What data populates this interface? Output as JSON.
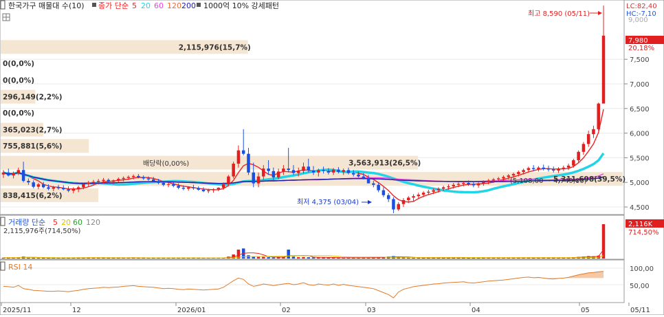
{
  "legend": {
    "title": "한국가구 매물대 수(10)",
    "ma_label": "종가 단순",
    "ma_periods": [
      "5",
      "20",
      "60",
      "120",
      "200"
    ],
    "ma_colors": [
      "#ee2222",
      "#22d4e6",
      "#e844e0",
      "#e86a3a",
      "#1a1aa8"
    ],
    "pattern_label": "1000억 10% 강세패턴"
  },
  "price_panel": {
    "y_ticks": [
      "7,500",
      "7,000",
      "6,500",
      "6,000",
      "5,500",
      "5,000",
      "4,500"
    ],
    "y_tick_values": [
      7500,
      7000,
      6500,
      6000,
      5500,
      5000,
      4500
    ],
    "lc": "LC:82,40",
    "hc": "HC:-7,10",
    "top_tick": "9,000",
    "current_price": "7,980",
    "current_change": "20,18%",
    "high_annotation": "최고 8,590 (05/11)",
    "low_annotation": "최저 4,375 (03/04)",
    "dividend_label": "배당락(0,00%)",
    "range_text": "(5,108,00 ~ 4,749,00)",
    "volume_profile": [
      {
        "label": "2,115,976(15,7%)",
        "price": 7750,
        "share": 15.7
      },
      {
        "label": "0(0,0%)",
        "price": 7420,
        "share": 0.0
      },
      {
        "label": "0(0,0%)",
        "price": 7080,
        "share": 0.0
      },
      {
        "label": "296,149(2,2%)",
        "price": 6740,
        "share": 2.2
      },
      {
        "label": "0(0,0%)",
        "price": 6410,
        "share": 0.0
      },
      {
        "label": "365,023(2,7%)",
        "price": 6070,
        "share": 2.7
      },
      {
        "label": "755,881(5,6%)",
        "price": 5740,
        "share": 5.6
      },
      {
        "label": "3,563,913(26,5%)",
        "price": 5400,
        "share": 26.5
      },
      {
        "label": "5,311,698(39,5%)",
        "price": 5070,
        "share": 39.5
      },
      {
        "label": "838,415(6,2%)",
        "price": 4740,
        "share": 6.2
      }
    ]
  },
  "volume_panel": {
    "legend": "거래량 단순",
    "ma_periods": [
      "5",
      "20",
      "60",
      "120"
    ],
    "ma_colors": [
      "#ee2222",
      "#e8c000",
      "#2aa02a",
      "#888888"
    ],
    "volume_text": "2,115,976주(714,50%)",
    "badge": "2,116K",
    "badge_pct": "714,50%"
  },
  "rsi_panel": {
    "legend": "RSI 14",
    "ticks": [
      "100,00",
      "50,00"
    ]
  },
  "x_axis": {
    "labels": [
      "2025/11",
      "12",
      "2026/01",
      "02",
      "03",
      "04",
      "05",
      "05/11"
    ]
  },
  "chart_data": {
    "type": "candlestick",
    "title": "한국가구 매물대 수(10)",
    "candles": [
      [
        5160,
        5250,
        5090,
        5200
      ],
      [
        5200,
        5280,
        5120,
        5140
      ],
      [
        5140,
        5220,
        5080,
        5190
      ],
      [
        5190,
        5300,
        5150,
        5250
      ],
      [
        5250,
        5420,
        5000,
        5030
      ],
      [
        5030,
        5080,
        4950,
        5000
      ],
      [
        5000,
        5040,
        4880,
        4910
      ],
      [
        4910,
        4990,
        4860,
        4960
      ],
      [
        4960,
        5010,
        4880,
        4900
      ],
      [
        4900,
        4960,
        4840,
        4870
      ],
      [
        4870,
        4930,
        4820,
        4900
      ],
      [
        4900,
        4950,
        4850,
        4880
      ],
      [
        4880,
        4940,
        4840,
        4860
      ],
      [
        4860,
        4920,
        4800,
        4830
      ],
      [
        4830,
        4900,
        4780,
        4860
      ],
      [
        4860,
        4930,
        4800,
        4900
      ],
      [
        4900,
        4990,
        4860,
        4970
      ],
      [
        4970,
        5030,
        4920,
        4990
      ],
      [
        4990,
        5050,
        4940,
        5010
      ],
      [
        5010,
        5070,
        4960,
        5030
      ],
      [
        5030,
        5090,
        4980,
        5050
      ],
      [
        5050,
        5080,
        4980,
        5010
      ],
      [
        5010,
        5060,
        4960,
        5040
      ],
      [
        5040,
        5100,
        5000,
        5070
      ],
      [
        5070,
        5120,
        5020,
        5090
      ],
      [
        5090,
        5140,
        5050,
        5110
      ],
      [
        5110,
        5160,
        5060,
        5130
      ],
      [
        5130,
        5170,
        5080,
        5100
      ],
      [
        5100,
        5140,
        5050,
        5080
      ],
      [
        5080,
        5120,
        5030,
        5060
      ],
      [
        5060,
        5110,
        5000,
        5020
      ],
      [
        5020,
        5070,
        4960,
        4990
      ],
      [
        4990,
        5030,
        4920,
        4950
      ],
      [
        4950,
        5000,
        4900,
        4960
      ],
      [
        4960,
        5000,
        4900,
        4930
      ],
      [
        4930,
        4980,
        4860,
        4890
      ],
      [
        4890,
        4940,
        4840,
        4870
      ],
      [
        4870,
        4920,
        4830,
        4900
      ],
      [
        4900,
        4950,
        4850,
        4880
      ],
      [
        4880,
        4920,
        4830,
        4850
      ],
      [
        4850,
        4900,
        4800,
        4820
      ],
      [
        4820,
        4870,
        4780,
        4840
      ],
      [
        4840,
        4880,
        4790,
        4860
      ],
      [
        4860,
        4900,
        4820,
        4890
      ],
      [
        4890,
        5000,
        4850,
        4960
      ],
      [
        4960,
        5150,
        4920,
        5120
      ],
      [
        5120,
        5420,
        5080,
        5380
      ],
      [
        5380,
        5750,
        5300,
        5650
      ],
      [
        5650,
        6080,
        5550,
        5580
      ],
      [
        5580,
        5700,
        5150,
        5200
      ],
      [
        5200,
        5400,
        4900,
        4980
      ],
      [
        4980,
        5200,
        4900,
        5120
      ],
      [
        5120,
        5350,
        5050,
        5280
      ],
      [
        5280,
        5450,
        5150,
        5230
      ],
      [
        5230,
        5300,
        5050,
        5100
      ],
      [
        5100,
        5280,
        5060,
        5220
      ],
      [
        5220,
        5350,
        5150,
        5280
      ],
      [
        5280,
        5700,
        5200,
        5250
      ],
      [
        5250,
        5350,
        5150,
        5190
      ],
      [
        5190,
        5300,
        5120,
        5230
      ],
      [
        5230,
        5400,
        5180,
        5320
      ],
      [
        5320,
        5480,
        5200,
        5240
      ],
      [
        5240,
        5330,
        5150,
        5200
      ],
      [
        5200,
        5280,
        5120,
        5250
      ],
      [
        5250,
        5320,
        5180,
        5230
      ],
      [
        5230,
        5290,
        5160,
        5200
      ],
      [
        5200,
        5290,
        5150,
        5260
      ],
      [
        5260,
        5310,
        5180,
        5210
      ],
      [
        5210,
        5280,
        5150,
        5250
      ],
      [
        5250,
        5300,
        5160,
        5190
      ],
      [
        5190,
        5250,
        5120,
        5160
      ],
      [
        5160,
        5220,
        5100,
        5120
      ],
      [
        5120,
        5190,
        5060,
        5080
      ],
      [
        5080,
        5150,
        5020,
        4980
      ],
      [
        4980,
        5030,
        4900,
        4950
      ],
      [
        4950,
        5000,
        4800,
        4840
      ],
      [
        4840,
        4900,
        4700,
        4740
      ],
      [
        4740,
        4780,
        4600,
        4660
      ],
      [
        4660,
        4700,
        4375,
        4450
      ],
      [
        4450,
        4600,
        4420,
        4560
      ],
      [
        4560,
        4680,
        4500,
        4640
      ],
      [
        4640,
        4720,
        4580,
        4690
      ],
      [
        4690,
        4760,
        4620,
        4720
      ],
      [
        4720,
        4790,
        4660,
        4750
      ],
      [
        4750,
        4820,
        4700,
        4790
      ],
      [
        4790,
        4850,
        4740,
        4810
      ],
      [
        4810,
        4880,
        4760,
        4840
      ],
      [
        4840,
        4900,
        4790,
        4870
      ],
      [
        4870,
        4930,
        4820,
        4900
      ],
      [
        4900,
        4960,
        4850,
        4920
      ],
      [
        4920,
        4990,
        4870,
        4950
      ],
      [
        4950,
        5010,
        4900,
        4970
      ],
      [
        4970,
        5030,
        4920,
        4990
      ],
      [
        4990,
        5040,
        4930,
        4960
      ],
      [
        4960,
        5020,
        4900,
        4940
      ],
      [
        4940,
        5000,
        4890,
        4980
      ],
      [
        4980,
        5040,
        4930,
        5010
      ],
      [
        5010,
        5070,
        4960,
        5040
      ],
      [
        5040,
        5090,
        4990,
        5060
      ],
      [
        5060,
        5110,
        5010,
        5080
      ],
      [
        5080,
        5140,
        5030,
        5110
      ],
      [
        5110,
        5170,
        5060,
        5140
      ],
      [
        5140,
        5200,
        5090,
        5170
      ],
      [
        5170,
        5240,
        5120,
        5210
      ],
      [
        5210,
        5280,
        5160,
        5250
      ],
      [
        5250,
        5320,
        5200,
        5290
      ],
      [
        5290,
        5350,
        5230,
        5270
      ],
      [
        5270,
        5330,
        5220,
        5300
      ],
      [
        5300,
        5360,
        5240,
        5280
      ],
      [
        5280,
        5340,
        5220,
        5260
      ],
      [
        5260,
        5320,
        5200,
        5240
      ],
      [
        5240,
        5310,
        5190,
        5280
      ],
      [
        5280,
        5340,
        5230,
        5300
      ],
      [
        5300,
        5380,
        5250,
        5340
      ],
      [
        5340,
        5480,
        5300,
        5450
      ],
      [
        5450,
        5650,
        5400,
        5620
      ],
      [
        5620,
        5820,
        5560,
        5780
      ],
      [
        5780,
        6050,
        5720,
        5980
      ],
      [
        5980,
        6150,
        5900,
        6080
      ],
      [
        6080,
        6620,
        6050,
        6600
      ],
      [
        6600,
        8590,
        7630,
        7980
      ]
    ],
    "volume_millions": [
      0.05,
      0.06,
      0.05,
      0.07,
      0.12,
      0.06,
      0.05,
      0.04,
      0.05,
      0.04,
      0.04,
      0.05,
      0.04,
      0.04,
      0.05,
      0.05,
      0.06,
      0.05,
      0.05,
      0.05,
      0.05,
      0.04,
      0.05,
      0.05,
      0.05,
      0.05,
      0.05,
      0.04,
      0.04,
      0.04,
      0.05,
      0.04,
      0.05,
      0.04,
      0.04,
      0.05,
      0.04,
      0.04,
      0.04,
      0.04,
      0.04,
      0.04,
      0.04,
      0.04,
      0.06,
      0.12,
      0.25,
      0.55,
      0.62,
      0.2,
      0.12,
      0.1,
      0.1,
      0.08,
      0.07,
      0.08,
      0.09,
      0.55,
      0.12,
      0.08,
      0.09,
      0.08,
      0.07,
      0.06,
      0.06,
      0.06,
      0.06,
      0.05,
      0.05,
      0.05,
      0.05,
      0.05,
      0.06,
      0.06,
      0.07,
      0.08,
      0.1,
      0.12,
      0.15,
      0.08,
      0.06,
      0.05,
      0.05,
      0.05,
      0.05,
      0.05,
      0.05,
      0.05,
      0.05,
      0.05,
      0.05,
      0.05,
      0.05,
      0.05,
      0.05,
      0.05,
      0.05,
      0.05,
      0.05,
      0.05,
      0.05,
      0.05,
      0.05,
      0.06,
      0.06,
      0.06,
      0.05,
      0.05,
      0.05,
      0.05,
      0.05,
      0.05,
      0.06,
      0.06,
      0.08,
      0.1,
      0.12,
      0.15,
      0.14,
      0.18,
      2.116
    ],
    "rsi": [
      45,
      44,
      42,
      48,
      38,
      36,
      33,
      32,
      31,
      30,
      30,
      31,
      30,
      29,
      31,
      33,
      36,
      38,
      39,
      40,
      42,
      41,
      42,
      43,
      45,
      46,
      47,
      45,
      44,
      43,
      42,
      40,
      38,
      39,
      38,
      36,
      35,
      37,
      36,
      35,
      34,
      35,
      36,
      37,
      42,
      52,
      62,
      70,
      66,
      52,
      45,
      48,
      52,
      50,
      47,
      50,
      52,
      54,
      50,
      52,
      56,
      50,
      48,
      52,
      50,
      49,
      52,
      48,
      51,
      48,
      46,
      44,
      42,
      40,
      38,
      32,
      26,
      20,
      10,
      28,
      36,
      40,
      44,
      46,
      48,
      50,
      52,
      53,
      55,
      56,
      57,
      58,
      59,
      56,
      55,
      57,
      59,
      61,
      62,
      63,
      64,
      66,
      68,
      70,
      72,
      73,
      71,
      72,
      70,
      68,
      67,
      69,
      70,
      72,
      76,
      80,
      83,
      86,
      87,
      89,
      90
    ],
    "ylim": [
      4200,
      9000
    ]
  }
}
